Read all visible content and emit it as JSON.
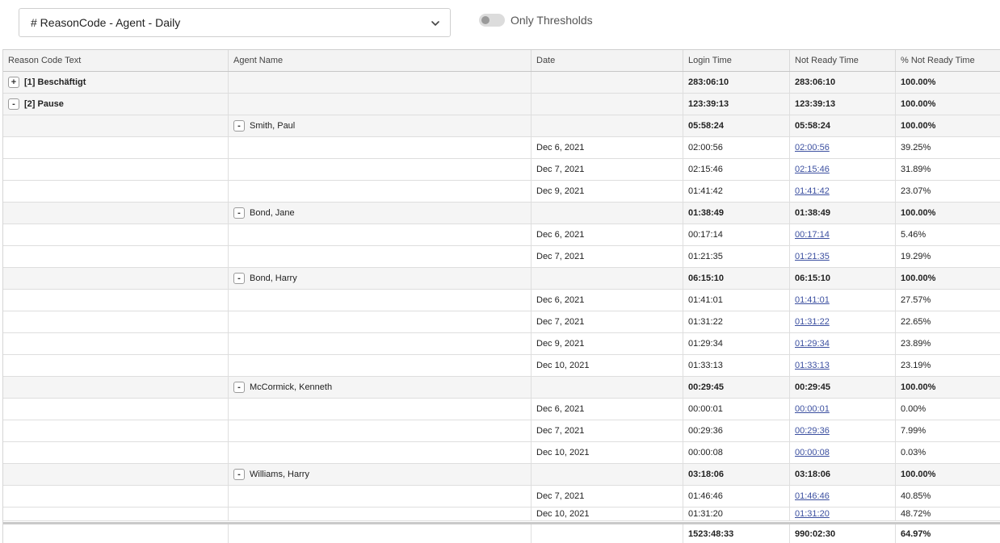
{
  "toolbar": {
    "report_name": "# ReasonCode - Agent - Daily",
    "toggle_label": "Only Thresholds",
    "toggle_on": false
  },
  "columns": [
    "Reason Code Text",
    "Agent Name",
    "Date",
    "Login Time",
    "Not Ready Time",
    "% Not Ready Time"
  ],
  "rows": [
    {
      "type": "reason",
      "expander": "+",
      "reason": "[1] Beschäftigt",
      "login": "283:06:10",
      "notready": "283:06:10",
      "pct": "100.00%"
    },
    {
      "type": "reason",
      "expander": "-",
      "reason": "[2] Pause",
      "login": "123:39:13",
      "notready": "123:39:13",
      "pct": "100.00%"
    },
    {
      "type": "agent",
      "expander": "-",
      "agent": "Smith, Paul",
      "login": "05:58:24",
      "notready": "05:58:24",
      "pct": "100.00%"
    },
    {
      "type": "day",
      "date": "Dec 6, 2021",
      "login": "02:00:56",
      "notready": "02:00:56",
      "pct": "39.25%"
    },
    {
      "type": "day",
      "date": "Dec 7, 2021",
      "login": "02:15:46",
      "notready": "02:15:46",
      "pct": "31.89%"
    },
    {
      "type": "day",
      "date": "Dec 9, 2021",
      "login": "01:41:42",
      "notready": "01:41:42",
      "pct": "23.07%"
    },
    {
      "type": "agent",
      "expander": "-",
      "agent": "Bond, Jane",
      "login": "01:38:49",
      "notready": "01:38:49",
      "pct": "100.00%"
    },
    {
      "type": "day",
      "date": "Dec 6, 2021",
      "login": "00:17:14",
      "notready": "00:17:14",
      "pct": "5.46%"
    },
    {
      "type": "day",
      "date": "Dec 7, 2021",
      "login": "01:21:35",
      "notready": "01:21:35",
      "pct": "19.29%"
    },
    {
      "type": "agent",
      "expander": "-",
      "agent": "Bond, Harry",
      "login": "06:15:10",
      "notready": "06:15:10",
      "pct": "100.00%"
    },
    {
      "type": "day",
      "date": "Dec 6, 2021",
      "login": "01:41:01",
      "notready": "01:41:01",
      "pct": "27.57%"
    },
    {
      "type": "day",
      "date": "Dec 7, 2021",
      "login": "01:31:22",
      "notready": "01:31:22",
      "pct": "22.65%"
    },
    {
      "type": "day",
      "date": "Dec 9, 2021",
      "login": "01:29:34",
      "notready": "01:29:34",
      "pct": "23.89%"
    },
    {
      "type": "day",
      "date": "Dec 10, 2021",
      "login": "01:33:13",
      "notready": "01:33:13",
      "pct": "23.19%"
    },
    {
      "type": "agent",
      "expander": "-",
      "agent": "McCormick, Kenneth",
      "login": "00:29:45",
      "notready": "00:29:45",
      "pct": "100.00%"
    },
    {
      "type": "day",
      "date": "Dec 6, 2021",
      "login": "00:00:01",
      "notready": "00:00:01",
      "pct": "0.00%"
    },
    {
      "type": "day",
      "date": "Dec 7, 2021",
      "login": "00:29:36",
      "notready": "00:29:36",
      "pct": "7.99%"
    },
    {
      "type": "day",
      "date": "Dec 10, 2021",
      "login": "00:00:08",
      "notready": "00:00:08",
      "pct": "0.03%"
    },
    {
      "type": "agent",
      "expander": "-",
      "agent": "Williams, Harry",
      "login": "03:18:06",
      "notready": "03:18:06",
      "pct": "100.00%"
    },
    {
      "type": "day",
      "date": "Dec 7, 2021",
      "login": "01:46:46",
      "notready": "01:46:46",
      "pct": "40.85%"
    },
    {
      "type": "day",
      "date": "Dec 10, 2021",
      "login": "01:31:20",
      "notready": "01:31:20",
      "pct": "48.72%"
    }
  ],
  "totals": {
    "login": "1523:48:33",
    "notready": "990:02:30",
    "pct": "64.97%"
  },
  "colors": {
    "link": "#3b4fa0",
    "group_bg": "#f5f5f5"
  }
}
